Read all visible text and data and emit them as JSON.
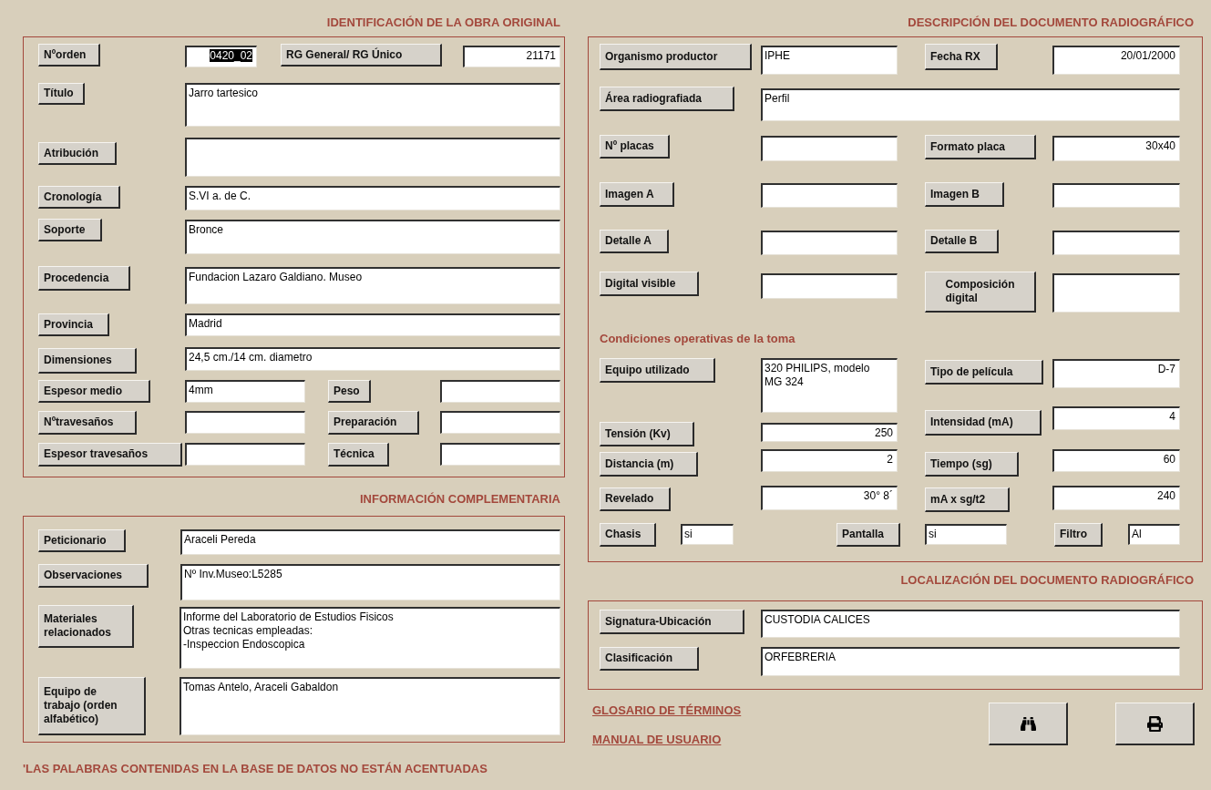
{
  "identificacion": {
    "title": "IDENTIFICACIÓN DE LA OBRA ORIGINAL",
    "rows": [
      [
        {
          "kind": "label",
          "text": "Nºorden"
        },
        {
          "kind": "number",
          "value": "0420_02",
          "text_selected": true
        },
        {
          "kind": "label",
          "text": "RG General/ RG Único"
        },
        {
          "kind": "number",
          "value": "21171"
        }
      ],
      [
        {
          "kind": "label",
          "text": "Título"
        },
        {
          "kind": "field",
          "value": "Jarro tartesico"
        }
      ],
      [
        {
          "kind": "label",
          "text": "Atribución"
        },
        {
          "kind": "field"
        }
      ],
      [
        {
          "kind": "label",
          "text": "Cronología"
        },
        {
          "kind": "field",
          "value": "S.VI a. de C."
        }
      ],
      [
        {
          "kind": "label",
          "text": "Soporte"
        },
        {
          "kind": "field",
          "value": "Bronce"
        }
      ],
      [
        {
          "kind": "label",
          "text": "Procedencia"
        },
        {
          "kind": "field",
          "value": "Fundacion Lazaro Galdiano. Museo"
        }
      ],
      [
        {
          "kind": "label",
          "text": "Provincia"
        },
        {
          "kind": "field",
          "value": "Madrid"
        }
      ],
      [
        {
          "kind": "label",
          "text": "Dimensiones"
        },
        {
          "kind": "field",
          "value": "24,5 cm./14 cm. diametro"
        }
      ],
      [
        {
          "kind": "label",
          "text": "Espesor medio"
        },
        {
          "kind": "field",
          "value": "4mm"
        },
        {
          "kind": "label",
          "text": "Peso"
        },
        {
          "kind": "field"
        }
      ],
      [
        {
          "kind": "label",
          "text": "Nºtravesaños"
        },
        {
          "kind": "field"
        },
        {
          "kind": "label",
          "text": "Preparación"
        },
        {
          "kind": "field"
        }
      ],
      [
        {
          "kind": "label",
          "text": "Espesor travesaños"
        },
        {
          "kind": "field"
        },
        {
          "kind": "label",
          "text": "Técnica"
        },
        {
          "kind": "field"
        }
      ]
    ]
  },
  "informacion": {
    "title": "INFORMACIÓN COMPLEMENTARIA",
    "rows": [
      [
        {
          "kind": "label",
          "text": "Peticionario"
        },
        {
          "kind": "field",
          "value": "Araceli Pereda"
        }
      ],
      [
        {
          "kind": "label",
          "text": "Observaciones"
        },
        {
          "kind": "field",
          "value": "Nº Inv.Museo:L5285"
        }
      ],
      [
        {
          "kind": "label",
          "text": "Materiales\nrelacionados"
        },
        {
          "kind": "field",
          "value": "Informe del Laboratorio de Estudios Fisicos\nOtras tecnicas empleadas:\n-Inspeccion Endoscopica"
        }
      ],
      [
        {
          "kind": "label",
          "text": "Equipo de\ntrabajo (orden\nalfabético)"
        },
        {
          "kind": "field",
          "value": "Tomas Antelo, Araceli Gabaldon"
        }
      ]
    ]
  },
  "note": "'LAS PALABRAS CONTENIDAS EN LA BASE DE DATOS NO ESTÁN ACENTUADAS",
  "descripcion": {
    "title": "DESCRIPCIÓN DEL DOCUMENTO RADIOGRÁFICO",
    "rows": [
      [
        {
          "kind": "label",
          "text": "Organismo productor"
        },
        {
          "kind": "field",
          "value": "IPHE"
        },
        {
          "kind": "label",
          "text": "Fecha RX"
        },
        {
          "kind": "number",
          "value": "20/01/2000"
        }
      ],
      [
        {
          "kind": "label",
          "text": "Área radiografiada"
        },
        {
          "kind": "field",
          "value": "Perfil"
        }
      ],
      [
        {
          "kind": "label",
          "text": "Nº placas"
        },
        {
          "kind": "field"
        },
        {
          "kind": "label",
          "text": "Formato placa"
        },
        {
          "kind": "number",
          "value": "30x40"
        }
      ],
      [
        {
          "kind": "label",
          "text": "Imagen A"
        },
        {
          "kind": "field"
        },
        {
          "kind": "label",
          "text": "Imagen B"
        },
        {
          "kind": "field"
        }
      ],
      [
        {
          "kind": "label",
          "text": "Detalle A"
        },
        {
          "kind": "field"
        },
        {
          "kind": "label",
          "text": "Detalle B"
        },
        {
          "kind": "field"
        }
      ],
      [
        {
          "kind": "label",
          "text": "Digital visible"
        },
        {
          "kind": "field"
        },
        {
          "kind": "label",
          "text": "Composición\ndigital"
        },
        {
          "kind": "field"
        }
      ]
    ],
    "subtitle": "Condiciones operativas de la toma",
    "operative_rows": [
      [
        {
          "kind": "label",
          "text": "Equipo utilizado"
        },
        {
          "kind": "field",
          "value": "320 PHILIPS, modelo\nMG 324"
        },
        {
          "kind": "label",
          "text": "Tipo de película"
        },
        {
          "kind": "number",
          "value": "D-7"
        }
      ],
      [
        {
          "kind": "label",
          "text": "Tensión (Kv)"
        },
        {
          "kind": "number",
          "value": "250"
        },
        {
          "kind": "label",
          "text": "Intensidad (mA)"
        },
        {
          "kind": "number",
          "value": "4"
        }
      ],
      [
        {
          "kind": "label",
          "text": "Distancia (m)"
        },
        {
          "kind": "number",
          "value": "2"
        },
        {
          "kind": "label",
          "text": "Tiempo (sg)"
        },
        {
          "kind": "number",
          "value": "60"
        }
      ],
      [
        {
          "kind": "label",
          "text": "Revelado"
        },
        {
          "kind": "number",
          "value": "30° 8´"
        },
        {
          "kind": "label",
          "text": "mA x sg/t2"
        },
        {
          "kind": "number",
          "value": "240"
        }
      ],
      [
        {
          "kind": "label",
          "text": "Chasis"
        },
        {
          "kind": "field",
          "value": "si"
        },
        {
          "kind": "label",
          "text": "Pantalla"
        },
        {
          "kind": "field",
          "value": "si"
        },
        {
          "kind": "label",
          "text": "Filtro"
        },
        {
          "kind": "field",
          "value": "Al"
        }
      ]
    ]
  },
  "localizacion": {
    "title": "LOCALIZACIÓN DEL DOCUMENTO RADIOGRÁFICO",
    "rows": [
      [
        {
          "kind": "label",
          "text": "Signatura-Ubicación"
        },
        {
          "kind": "field",
          "value": "CUSTODIA CALICES"
        }
      ],
      [
        {
          "kind": "label",
          "text": "Clasificación"
        },
        {
          "kind": "field",
          "value": "ORFEBRERIA"
        }
      ]
    ]
  },
  "links": [
    "GLOSARIO DE TÉRMINOS",
    "MANUAL DE USUARIO"
  ],
  "tool_buttons": [
    {
      "kind": "search"
    },
    {
      "kind": "print"
    }
  ]
}
